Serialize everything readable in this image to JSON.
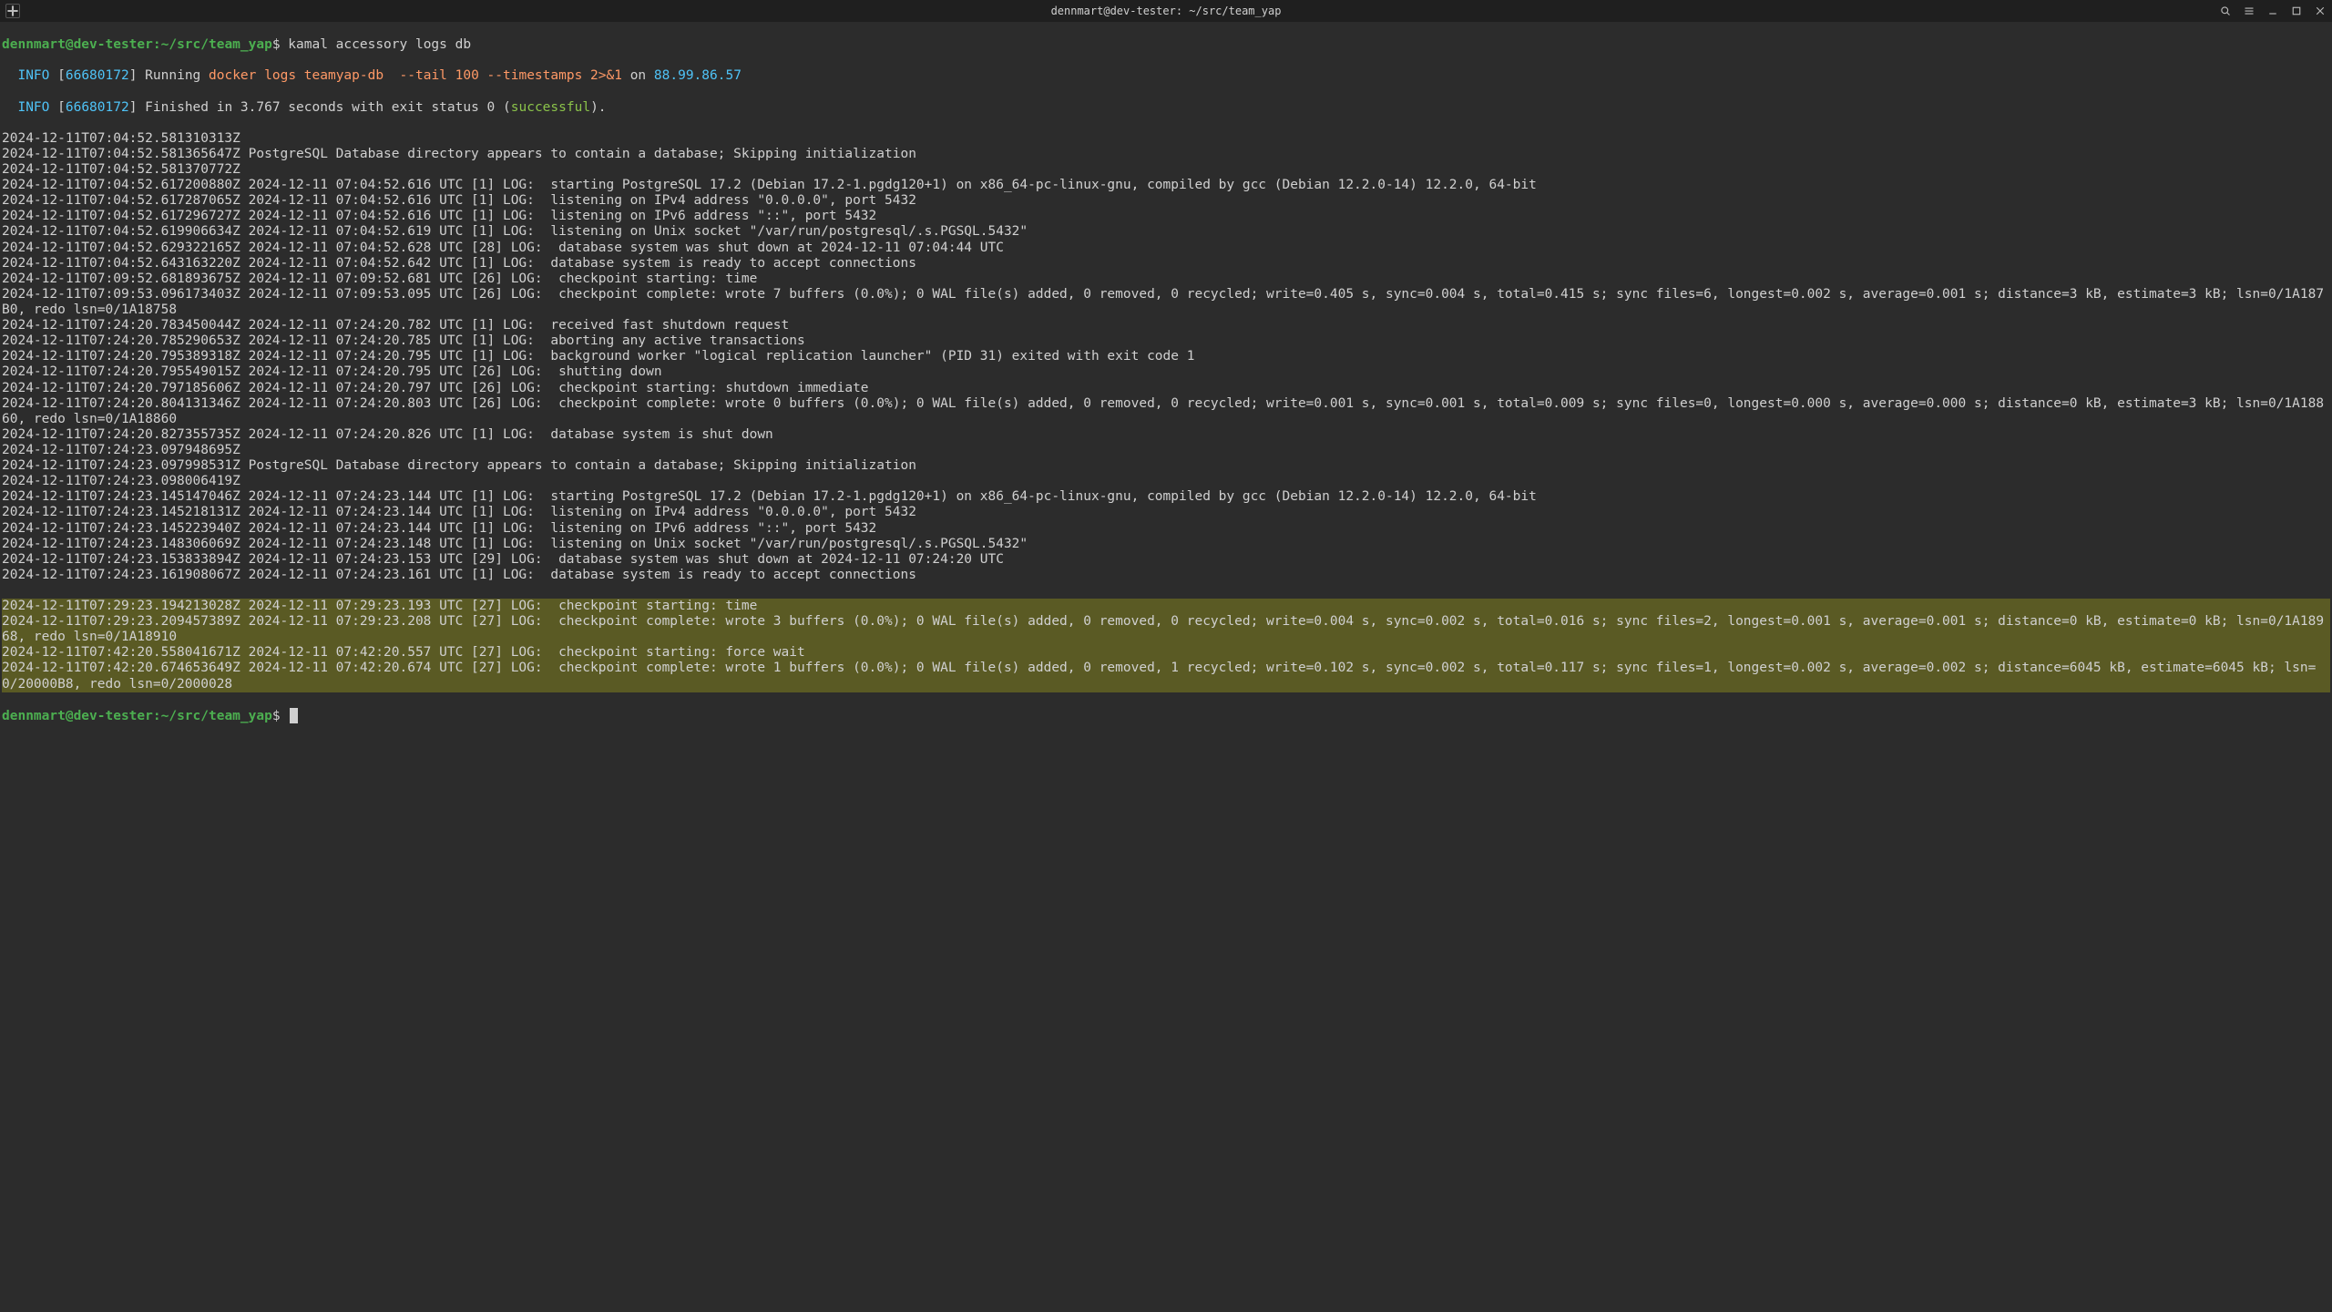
{
  "window": {
    "title": "dennmart@dev-tester: ~/src/team_yap"
  },
  "prompt": {
    "userhost": "dennmart@dev-tester",
    "sep": ":",
    "path": "~/src/team_yap",
    "symbol": "$"
  },
  "command": "kamal accessory logs db",
  "info1": {
    "tag": "INFO",
    "id": "66680172",
    "pre": "Running",
    "docker": "docker logs teamyap-db  --tail 100 --timestamps 2>&1",
    "on": "on",
    "ip": "88.99.86.57"
  },
  "info2": {
    "tag": "INFO",
    "id": "66680172",
    "txt_a": "Finished in 3.767 seconds with exit status 0 (",
    "ok": "successful",
    "txt_b": ")."
  },
  "logs": [
    "2024-12-11T07:04:52.581310313Z",
    "2024-12-11T07:04:52.581365647Z PostgreSQL Database directory appears to contain a database; Skipping initialization",
    "2024-12-11T07:04:52.581370772Z",
    "2024-12-11T07:04:52.617200880Z 2024-12-11 07:04:52.616 UTC [1] LOG:  starting PostgreSQL 17.2 (Debian 17.2-1.pgdg120+1) on x86_64-pc-linux-gnu, compiled by gcc (Debian 12.2.0-14) 12.2.0, 64-bit",
    "2024-12-11T07:04:52.617287065Z 2024-12-11 07:04:52.616 UTC [1] LOG:  listening on IPv4 address \"0.0.0.0\", port 5432",
    "2024-12-11T07:04:52.617296727Z 2024-12-11 07:04:52.616 UTC [1] LOG:  listening on IPv6 address \"::\", port 5432",
    "2024-12-11T07:04:52.619906634Z 2024-12-11 07:04:52.619 UTC [1] LOG:  listening on Unix socket \"/var/run/postgresql/.s.PGSQL.5432\"",
    "2024-12-11T07:04:52.629322165Z 2024-12-11 07:04:52.628 UTC [28] LOG:  database system was shut down at 2024-12-11 07:04:44 UTC",
    "2024-12-11T07:04:52.643163220Z 2024-12-11 07:04:52.642 UTC [1] LOG:  database system is ready to accept connections",
    "2024-12-11T07:09:52.681893675Z 2024-12-11 07:09:52.681 UTC [26] LOG:  checkpoint starting: time",
    "2024-12-11T07:09:53.096173403Z 2024-12-11 07:09:53.095 UTC [26] LOG:  checkpoint complete: wrote 7 buffers (0.0%); 0 WAL file(s) added, 0 removed, 0 recycled; write=0.405 s, sync=0.004 s, total=0.415 s; sync files=6, longest=0.002 s, average=0.001 s; distance=3 kB, estimate=3 kB; lsn=0/1A187B0, redo lsn=0/1A18758",
    "2024-12-11T07:24:20.783450044Z 2024-12-11 07:24:20.782 UTC [1] LOG:  received fast shutdown request",
    "2024-12-11T07:24:20.785290653Z 2024-12-11 07:24:20.785 UTC [1] LOG:  aborting any active transactions",
    "2024-12-11T07:24:20.795389318Z 2024-12-11 07:24:20.795 UTC [1] LOG:  background worker \"logical replication launcher\" (PID 31) exited with exit code 1",
    "2024-12-11T07:24:20.795549015Z 2024-12-11 07:24:20.795 UTC [26] LOG:  shutting down",
    "2024-12-11T07:24:20.797185606Z 2024-12-11 07:24:20.797 UTC [26] LOG:  checkpoint starting: shutdown immediate",
    "2024-12-11T07:24:20.804131346Z 2024-12-11 07:24:20.803 UTC [26] LOG:  checkpoint complete: wrote 0 buffers (0.0%); 0 WAL file(s) added, 0 removed, 0 recycled; write=0.001 s, sync=0.001 s, total=0.009 s; sync files=0, longest=0.000 s, average=0.000 s; distance=0 kB, estimate=3 kB; lsn=0/1A18860, redo lsn=0/1A18860",
    "2024-12-11T07:24:20.827355735Z 2024-12-11 07:24:20.826 UTC [1] LOG:  database system is shut down",
    "2024-12-11T07:24:23.097948695Z",
    "2024-12-11T07:24:23.097998531Z PostgreSQL Database directory appears to contain a database; Skipping initialization",
    "2024-12-11T07:24:23.098006419Z",
    "2024-12-11T07:24:23.145147046Z 2024-12-11 07:24:23.144 UTC [1] LOG:  starting PostgreSQL 17.2 (Debian 17.2-1.pgdg120+1) on x86_64-pc-linux-gnu, compiled by gcc (Debian 12.2.0-14) 12.2.0, 64-bit",
    "2024-12-11T07:24:23.145218131Z 2024-12-11 07:24:23.144 UTC [1] LOG:  listening on IPv4 address \"0.0.0.0\", port 5432",
    "2024-12-11T07:24:23.145223940Z 2024-12-11 07:24:23.144 UTC [1] LOG:  listening on IPv6 address \"::\", port 5432",
    "2024-12-11T07:24:23.148306069Z 2024-12-11 07:24:23.148 UTC [1] LOG:  listening on Unix socket \"/var/run/postgresql/.s.PGSQL.5432\"",
    "2024-12-11T07:24:23.153833894Z 2024-12-11 07:24:23.153 UTC [29] LOG:  database system was shut down at 2024-12-11 07:24:20 UTC",
    "2024-12-11T07:24:23.161908067Z 2024-12-11 07:24:23.161 UTC [1] LOG:  database system is ready to accept connections"
  ],
  "hl_logs": [
    "2024-12-11T07:29:23.194213028Z 2024-12-11 07:29:23.193 UTC [27] LOG:  checkpoint starting: time",
    "2024-12-11T07:29:23.209457389Z 2024-12-11 07:29:23.208 UTC [27] LOG:  checkpoint complete: wrote 3 buffers (0.0%); 0 WAL file(s) added, 0 removed, 0 recycled; write=0.004 s, sync=0.002 s, total=0.016 s; sync files=2, longest=0.001 s, average=0.001 s; distance=0 kB, estimate=0 kB; lsn=0/1A18968, redo lsn=0/1A18910",
    "2024-12-11T07:42:20.558041671Z 2024-12-11 07:42:20.557 UTC [27] LOG:  checkpoint starting: force wait",
    "2024-12-11T07:42:20.674653649Z 2024-12-11 07:42:20.674 UTC [27] LOG:  checkpoint complete: wrote 1 buffers (0.0%); 0 WAL file(s) added, 0 removed, 1 recycled; write=0.102 s, sync=0.002 s, total=0.117 s; sync files=1, longest=0.002 s, average=0.002 s; distance=6045 kB, estimate=6045 kB; lsn=0/20000B8, redo lsn=0/2000028"
  ]
}
